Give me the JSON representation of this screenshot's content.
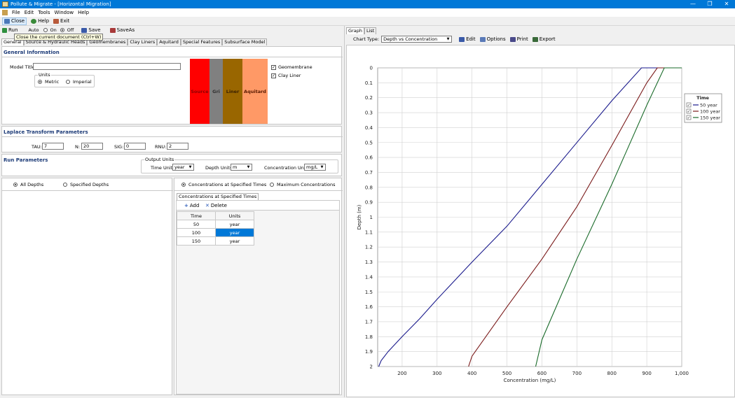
{
  "window": {
    "title": "Pollute & Migrate - [Horizontal Migration]",
    "minimize": "—",
    "restore": "❐",
    "close": "✕"
  },
  "menu": [
    "File",
    "Edit",
    "Tools",
    "Window",
    "Help"
  ],
  "toolbar": {
    "close": "Close",
    "help": "Help",
    "exit": "Exit"
  },
  "doc_toolbar": {
    "run": "Run",
    "auto": "Auto",
    "on": "On",
    "off": "Off",
    "save": "Save",
    "saveas": "SaveAs"
  },
  "tooltip": "Close the current document (Ctrl+W)",
  "tabs": [
    "General",
    "Source & Hydraulic Heads",
    "Geomembranes",
    "Clay Liners",
    "Aquitard",
    "Special Features",
    "Subsurface Model"
  ],
  "general": {
    "header": "General Information",
    "model_title_label": "Model Title:",
    "model_title_value": "",
    "units_group": "Units",
    "metric": "Metric",
    "imperial": "Imperial",
    "layers": [
      "Source",
      "Gri",
      "Liner",
      "Aquitard"
    ],
    "geomembrane": "Geomembrane",
    "clay_liner": "Clay Liner"
  },
  "laplace": {
    "header": "Laplace Transform Parameters",
    "tau_label": "TAU:",
    "tau": "7",
    "n_label": "N:",
    "n": "20",
    "sig_label": "SIG:",
    "sig": "0",
    "rnu_label": "RNU:",
    "rnu": "2"
  },
  "run": {
    "header": "Run Parameters",
    "output_units": "Output Units",
    "time_units_label": "Time Units:",
    "time_units": "year",
    "depth_units_label": "Depth Units:",
    "depth_units": "m",
    "conc_units_label": "Concentration Units:",
    "conc_units": "mg/L",
    "all_depths": "All Depths",
    "specified_depths": "Specified Depths",
    "conc_specified": "Concentrations at Specified Times",
    "max_conc": "Maximum Concentrations",
    "subtab": "Concentrations at Specified Times",
    "add": "Add",
    "delete": "Delete",
    "table_headers": [
      "Time",
      "Units"
    ],
    "rows": [
      [
        "50",
        "year"
      ],
      [
        "100",
        "year"
      ],
      [
        "150",
        "year"
      ]
    ]
  },
  "right": {
    "tabs": [
      "Graph",
      "List"
    ],
    "chart_type_label": "Chart Type:",
    "chart_type": "Depth vs Concentration",
    "edit": "Edit",
    "options": "Options",
    "print": "Print",
    "export": "Export"
  },
  "chart_data": {
    "type": "line",
    "xlabel": "Concentration (mg/L)",
    "ylabel": "Depth (m)",
    "xlim": [
      130,
      1000
    ],
    "ylim": [
      0,
      2
    ],
    "y_inverted": true,
    "grid": true,
    "legend_title": "Time",
    "legend_position": "right",
    "x_ticks": [
      "200",
      "300",
      "400",
      "500",
      "600",
      "700",
      "800",
      "900",
      "1,000"
    ],
    "x_tick_values": [
      200,
      300,
      400,
      500,
      600,
      700,
      800,
      900,
      1000
    ],
    "y_ticks": [
      "0",
      "0.1",
      "0.2",
      "0.3",
      "0.4",
      "0.5",
      "0.6",
      "0.7",
      "0.8",
      "0.9",
      "1",
      "1.1",
      "1.2",
      "1.3",
      "1.4",
      "1.5",
      "1.6",
      "1.7",
      "1.8",
      "1.9",
      "2"
    ],
    "series": [
      {
        "name": "50 year",
        "color": "#1a1a8c",
        "x": [
          1000,
          885,
          800,
          700,
          600,
          500,
          400,
          300,
          250,
          200,
          160,
          140,
          133
        ],
        "y": [
          0,
          0,
          0.22,
          0.5,
          0.78,
          1.06,
          1.3,
          1.55,
          1.68,
          1.8,
          1.9,
          1.96,
          2.0
        ]
      },
      {
        "name": "100 year",
        "color": "#7a1a1a",
        "x": [
          1000,
          930,
          900,
          800,
          700,
          600,
          500,
          400,
          390
        ],
        "y": [
          0,
          0,
          0.1,
          0.52,
          0.93,
          1.28,
          1.6,
          1.93,
          2.0
        ]
      },
      {
        "name": "150 year",
        "color": "#1a6b2a",
        "x": [
          1000,
          950,
          900,
          800,
          700,
          600,
          582
        ],
        "y": [
          0,
          0,
          0.25,
          0.78,
          1.28,
          1.82,
          2.0
        ]
      }
    ]
  }
}
